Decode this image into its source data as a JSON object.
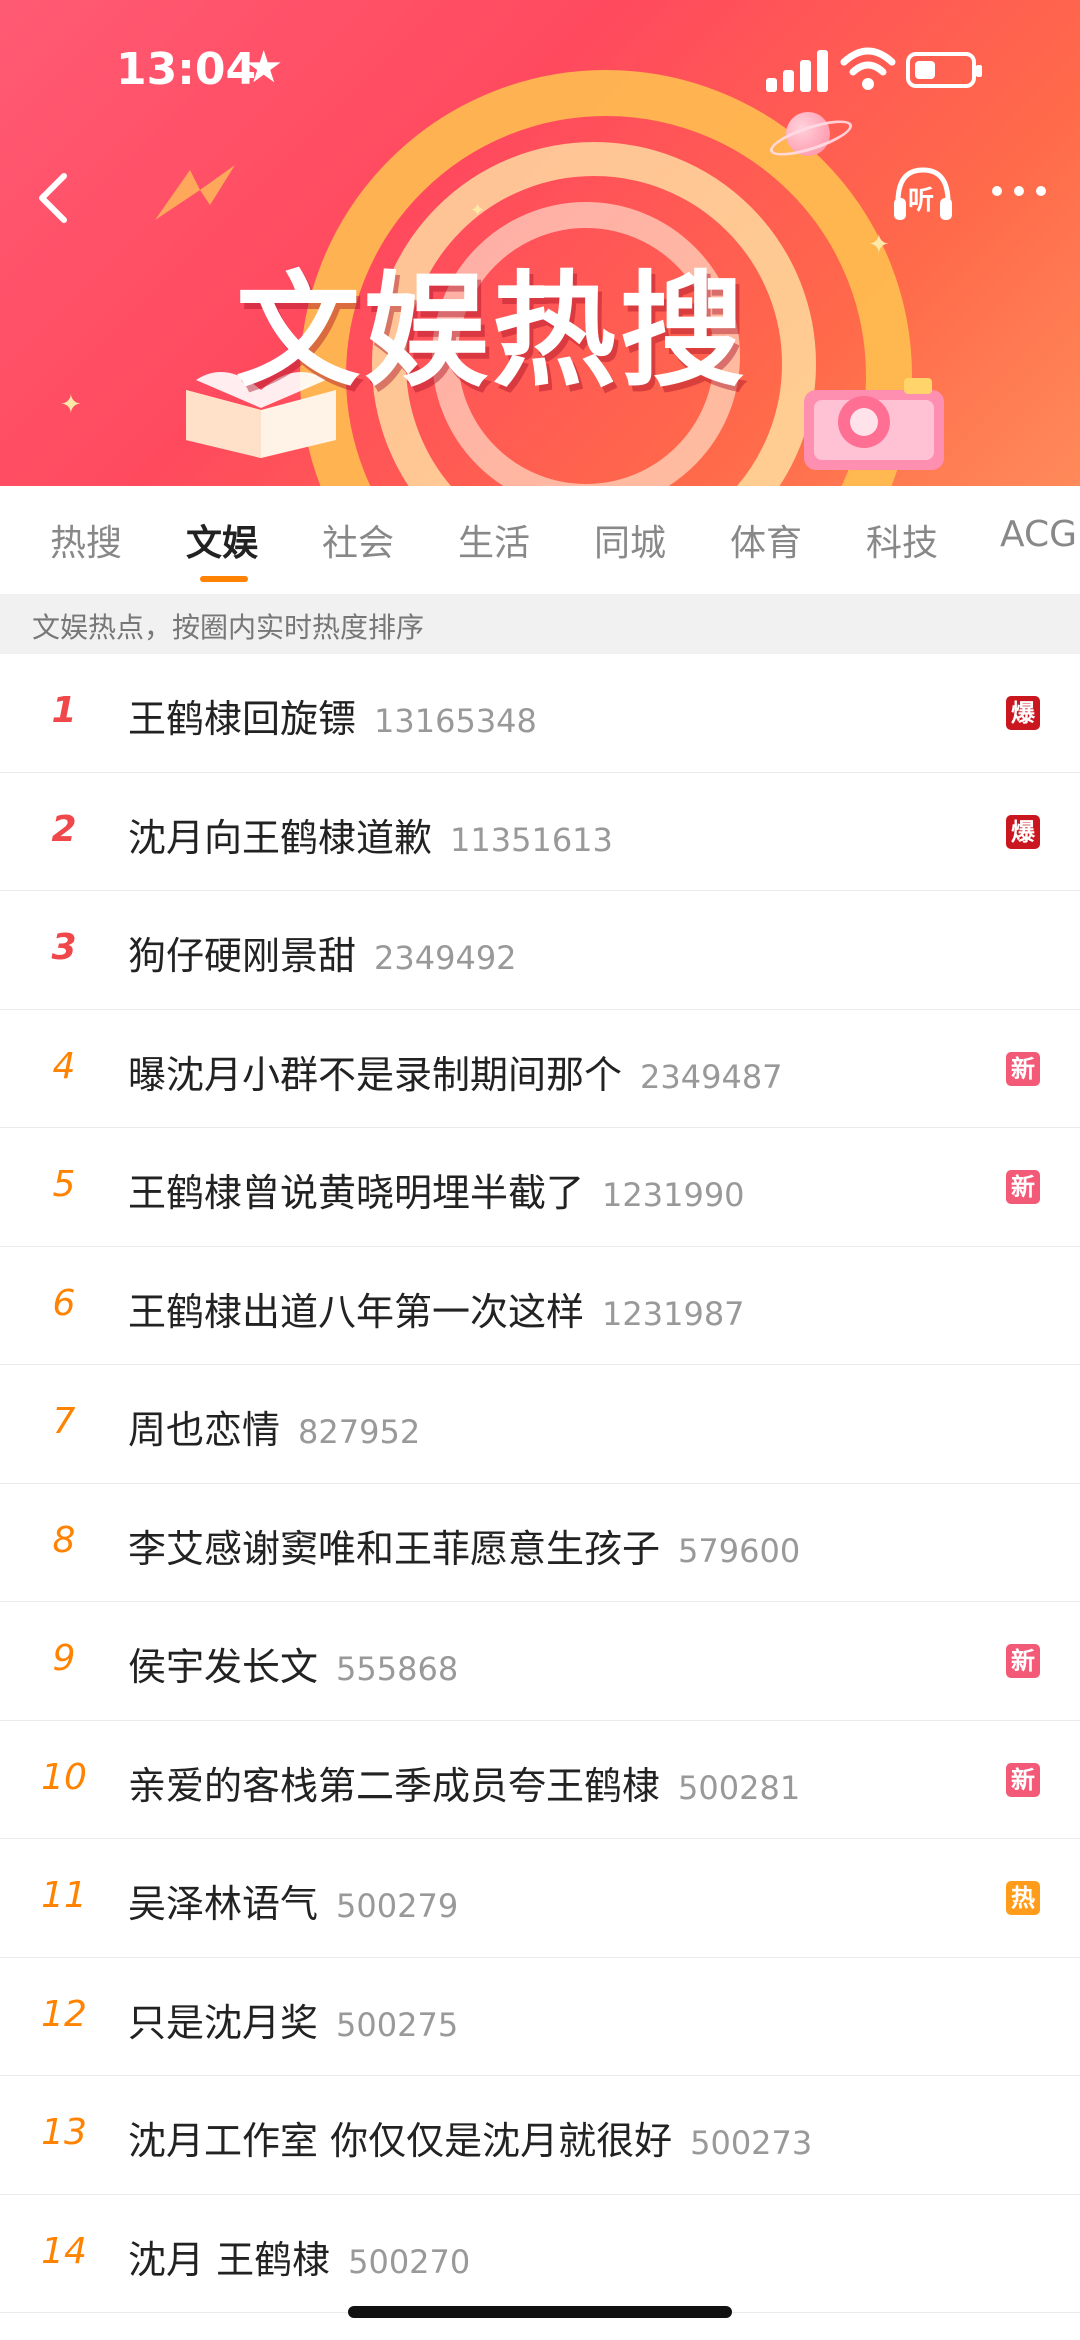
{
  "status": {
    "time": "13:04"
  },
  "banner": {
    "title": "文娱热搜",
    "listen_label": "听"
  },
  "tabs": [
    {
      "label": "热搜"
    },
    {
      "label": "文娱",
      "active": true
    },
    {
      "label": "社会"
    },
    {
      "label": "生活"
    },
    {
      "label": "同城"
    },
    {
      "label": "体育"
    },
    {
      "label": "科技"
    },
    {
      "label": "ACG"
    }
  ],
  "subheader": "文娱热点，按圈内实时热度排序",
  "items": [
    {
      "rank": "1",
      "topic": "王鹤棣回旋镖",
      "count": "13165348",
      "badge": "爆",
      "badge_type": "bao"
    },
    {
      "rank": "2",
      "topic": "沈月向王鹤棣道歉",
      "count": "11351613",
      "badge": "爆",
      "badge_type": "bao"
    },
    {
      "rank": "3",
      "topic": "狗仔硬刚景甜",
      "count": "2349492",
      "badge": "",
      "badge_type": ""
    },
    {
      "rank": "4",
      "topic": "曝沈月小群不是录制期间那个",
      "count": "2349487",
      "badge": "新",
      "badge_type": "xin"
    },
    {
      "rank": "5",
      "topic": "王鹤棣曾说黄晓明埋半截了",
      "count": "1231990",
      "badge": "新",
      "badge_type": "xin"
    },
    {
      "rank": "6",
      "topic": "王鹤棣出道八年第一次这样",
      "count": "1231987",
      "badge": "",
      "badge_type": ""
    },
    {
      "rank": "7",
      "topic": "周也恋情",
      "count": "827952",
      "badge": "",
      "badge_type": ""
    },
    {
      "rank": "8",
      "topic": "李艾感谢窦唯和王菲愿意生孩子",
      "count": "579600",
      "badge": "",
      "badge_type": ""
    },
    {
      "rank": "9",
      "topic": "侯宇发长文",
      "count": "555868",
      "badge": "新",
      "badge_type": "xin"
    },
    {
      "rank": "10",
      "topic": "亲爱的客栈第二季成员夸王鹤棣",
      "count": "500281",
      "badge": "新",
      "badge_type": "xin"
    },
    {
      "rank": "11",
      "topic": "吴泽林语气",
      "count": "500279",
      "badge": "热",
      "badge_type": "re"
    },
    {
      "rank": "12",
      "topic": "只是沈月奖",
      "count": "500275",
      "badge": "",
      "badge_type": ""
    },
    {
      "rank": "13",
      "topic": "沈月工作室 你仅仅是沈月就很好",
      "count": "500273",
      "badge": "",
      "badge_type": ""
    },
    {
      "rank": "14",
      "topic": "沈月 王鹤棣",
      "count": "500270",
      "badge": "",
      "badge_type": ""
    }
  ],
  "colors": {
    "accent": "#ff8200",
    "rank_top": "#f0474a",
    "badge_bao": "#c9161f",
    "badge_xin": "#f25a78",
    "badge_re": "#ff9c1c"
  }
}
